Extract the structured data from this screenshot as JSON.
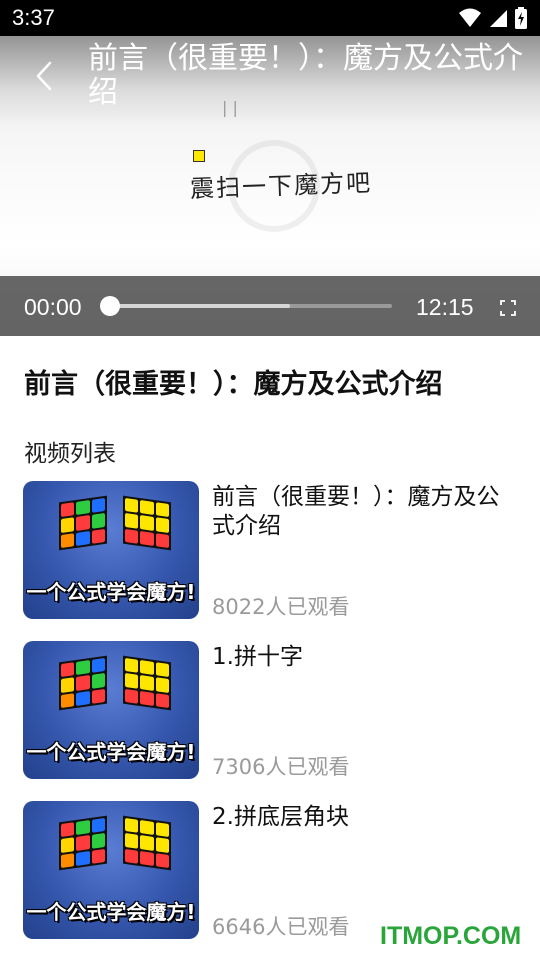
{
  "status_bar": {
    "time": "3:37",
    "icons": [
      "wifi-icon",
      "signal-icon",
      "battery-icon"
    ]
  },
  "player": {
    "title": "前言（很重要！）：魔方及公式介绍",
    "frame_text": "震扫一下魔方吧",
    "current_time": "00:00",
    "total_time": "12:15",
    "played_fraction": 0,
    "buffered_fraction": 0.64
  },
  "content": {
    "heading": "前言（很重要！）：魔方及公式介绍",
    "section_label": "视频列表",
    "thumbnail_caption": "一个公式学会魔方!",
    "videos": [
      {
        "title": "前言（很重要！）：魔方及公式介绍",
        "views": "8022人已观看"
      },
      {
        "title": "1.拼十字",
        "views": "7306人已观看"
      },
      {
        "title": "2.拼底层角块",
        "views": "6646人已观看"
      }
    ]
  },
  "watermark": "ITMOP.COM",
  "colors": {
    "status_bar_bg": "#000000",
    "control_bar_bg": "#3c3c3c",
    "views_text": "#9a9a9a",
    "watermark_green": "#2aa53a",
    "thumbnail_blue": "#3557ad"
  }
}
